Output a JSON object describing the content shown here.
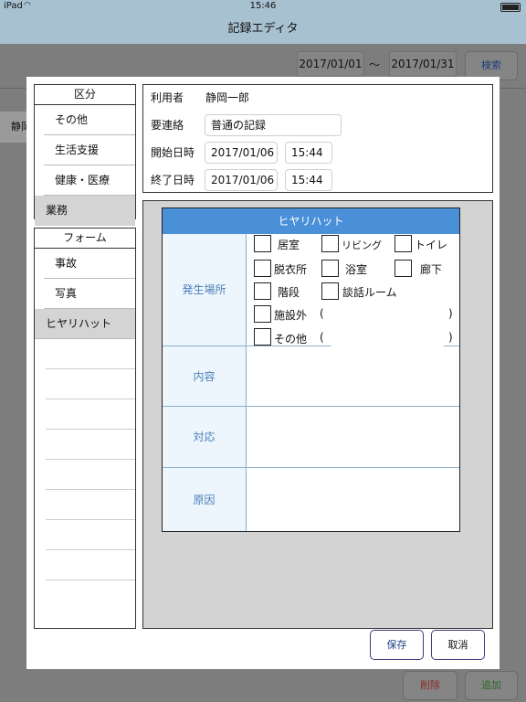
{
  "status_bar": {
    "device": "iPad",
    "time": "15:46"
  },
  "nav": {
    "title": "記録エディタ"
  },
  "background": {
    "date_from": "2017/01/01",
    "date_sep": "〜",
    "date_to": "2017/01/31",
    "search_label": "検索",
    "partial_name": "静岡",
    "delete_label": "削除",
    "add_label": "追加"
  },
  "category": {
    "header": "区分",
    "items": [
      "その他",
      "生活支援",
      "健康・医療",
      "業務"
    ],
    "selected": 3
  },
  "form_list": {
    "header": "フォーム",
    "items": [
      "事故",
      "写真",
      "ヒヤリハット"
    ],
    "selected": 2
  },
  "record": {
    "user_label": "利用者",
    "user_value": "静岡一郎",
    "contact_label": "要連絡",
    "contact_value": "普通の記録",
    "start_label": "開始日時",
    "start_date": "2017/01/06",
    "start_time": "15:44",
    "end_label": "終了日時",
    "end_date": "2017/01/06",
    "end_time": "15:44"
  },
  "hiyari": {
    "title": "ヒヤリハット",
    "place_label": "発生場所",
    "places": {
      "kyoshitsu": "居室",
      "living": "リビング",
      "toilet": "トイレ",
      "datsui": "脱衣所",
      "yokushitsu": "浴室",
      "roka": "廊下",
      "kaidan": "階段",
      "danwa": "談話ルーム",
      "shisetsugai": "施設外",
      "sonota": "その他",
      "paren_open": "(",
      "paren_close": ")"
    },
    "content_label": "内容",
    "response_label": "対応",
    "cause_label": "原因"
  },
  "actions": {
    "save": "保存",
    "cancel": "取消"
  },
  "colors": {
    "header_blue": "#4a90d9",
    "nav_bg": "#a7c1d1",
    "label_blue": "#4a7fb8"
  }
}
